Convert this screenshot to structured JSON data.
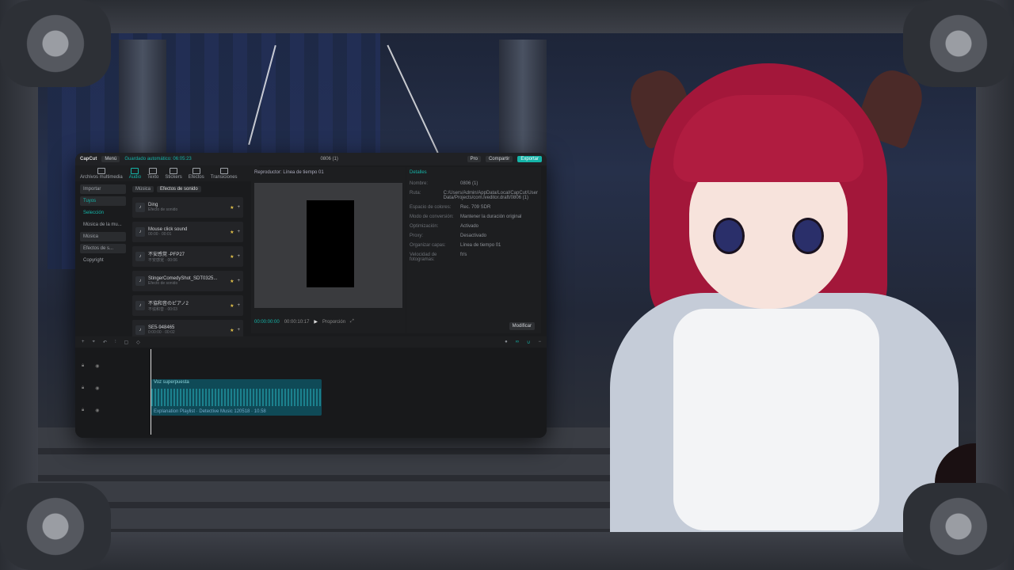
{
  "colors": {
    "accent": "#15b4a8",
    "window_bg": "#1a1b1d",
    "hair": "#a3173a"
  },
  "app": {
    "name": "CapCut",
    "menu_label": "Menú",
    "autosave": "Guardado automático: 06:05:23",
    "project_title": "0806 (1)",
    "pro_label": "Pro",
    "share_label": "Compartir",
    "export_label": "Exportar"
  },
  "toolbar": {
    "items": [
      {
        "label": "Archivos multimedia",
        "icon": "media-icon"
      },
      {
        "label": "Audio",
        "icon": "audio-icon"
      },
      {
        "label": "Texto",
        "icon": "text-icon"
      },
      {
        "label": "Stickers",
        "icon": "sticker-icon"
      },
      {
        "label": "Efectos",
        "icon": "effects-icon"
      },
      {
        "label": "Transiciones",
        "icon": "transition-icon"
      }
    ]
  },
  "left_nav": {
    "items": [
      "Importar",
      "Tuyos",
      "Selección",
      "Música de la mu...",
      "Música",
      "Efectos de s...",
      "Copyright"
    ]
  },
  "filters": {
    "music": "Música",
    "sfx": "Efectos de sonido"
  },
  "sound_list": [
    {
      "name": "Ding",
      "sub": "Efecto de sonido"
    },
    {
      "name": "Mouse click sound",
      "sub": "00:00 · 00:01"
    },
    {
      "name": "不安感覚 -PFP27",
      "sub": "不安感覚 · 00:06"
    },
    {
      "name": "StingerComedyShot_SDT0325...",
      "sub": "Efecto de sonido"
    },
    {
      "name": "不協和音のピアノ2",
      "sub": "不協和音 · 00:03"
    },
    {
      "name": "SE5-948465",
      "sub": "0:00:00 · 00:02"
    }
  ],
  "player": {
    "title": "Reproductor: Línea de tiempo 01",
    "timecode": "00:00:00:00",
    "duration": "00:00:10:17",
    "ratio_label": "Proporción"
  },
  "details": {
    "title": "Detalles",
    "rows": [
      {
        "k": "Nombre:",
        "v": "0806 (1)"
      },
      {
        "k": "Ruta:",
        "v": "C:/Users/Admin/AppData/Local/CapCut/User Data/Projects/com.lveditor.draft/0806 (1)"
      },
      {
        "k": "Espacio de colores:",
        "v": "Rec. 709 SDR"
      },
      {
        "k": "Modo de conversión:",
        "v": "Mantener la duración original"
      },
      {
        "k": "Optimización:",
        "v": "Activado"
      },
      {
        "k": "Proxy:",
        "v": "Desactivado"
      },
      {
        "k": "Organizar capas:",
        "v": "Línea de tiempo 01"
      },
      {
        "k": "Velocidad de fotogramas:",
        "v": "fr/s"
      }
    ],
    "modify_label": "Modificar"
  },
  "timeline": {
    "clip_title": "Voz superpuesta",
    "clip_footer": "Explanation Playlist · Detective Music 120518 · 10.58"
  }
}
